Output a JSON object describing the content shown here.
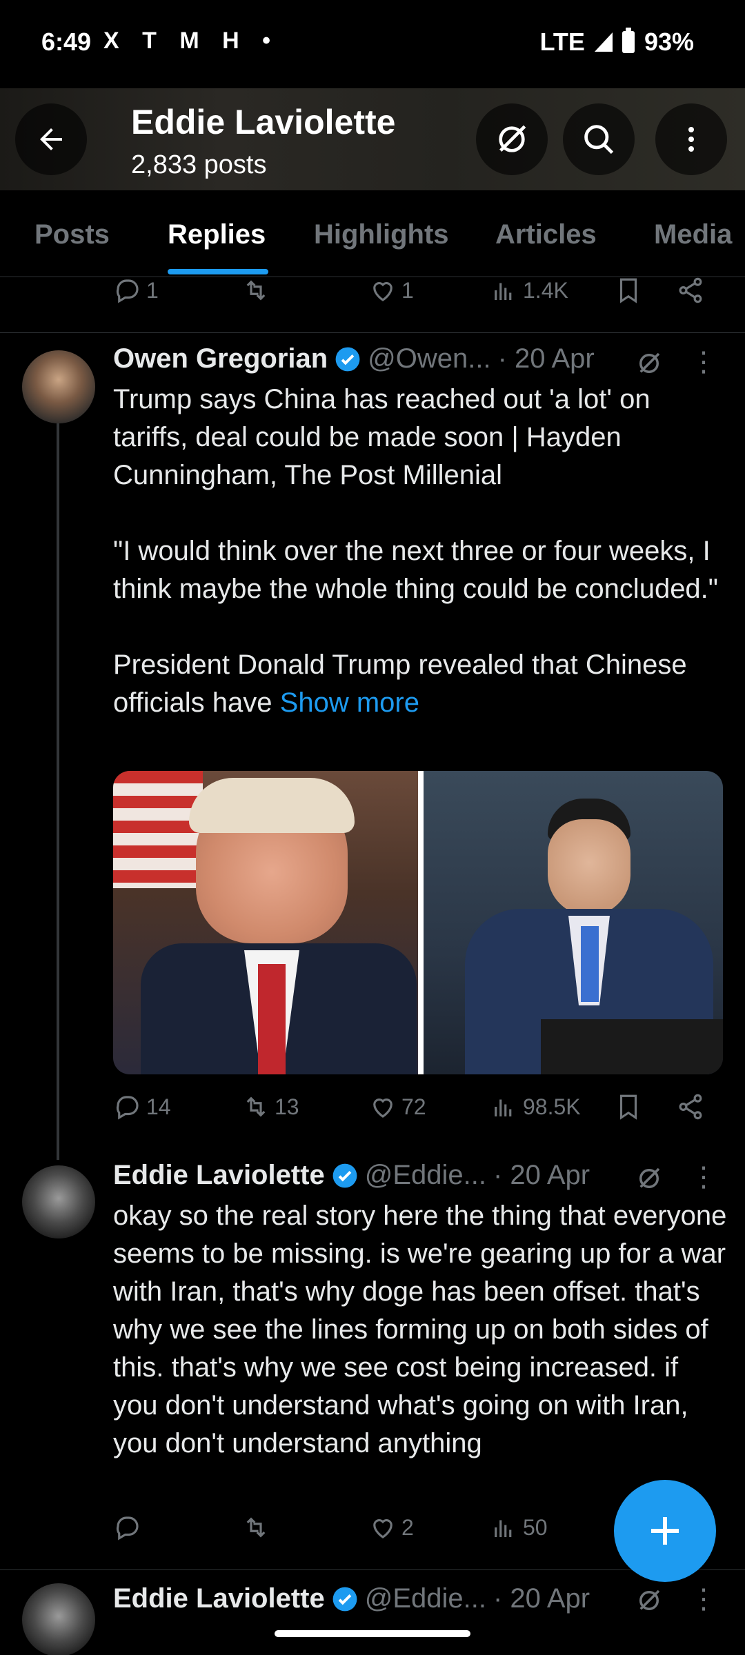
{
  "status_bar": {
    "time": "6:49",
    "network": "LTE",
    "battery": "93%",
    "notif_icons": [
      "X",
      "T",
      "M",
      "H",
      "•"
    ]
  },
  "header": {
    "title": "Eddie Laviolette",
    "subtitle": "2,833 posts"
  },
  "tabs": [
    {
      "label": "Posts",
      "active": false
    },
    {
      "label": "Replies",
      "active": true
    },
    {
      "label": "Highlights",
      "active": false
    },
    {
      "label": "Articles",
      "active": false
    },
    {
      "label": "Media",
      "active": false
    }
  ],
  "prev_tweet_actions": {
    "replies": "1",
    "reposts": "",
    "likes": "1",
    "views": "1.4K"
  },
  "tweet1": {
    "name": "Owen Gregorian",
    "handle": "@Owen...",
    "date": "· 20 Apr",
    "body_p1": "Trump says China has reached out 'a lot' on tariffs, deal could be made soon | Hayden Cunningham, The Post Millenial",
    "body_p2": "\"I would think over the next three or four weeks, I think maybe the whole thing could be concluded.\"",
    "body_p3": "President Donald Trump revealed that Chinese officials have",
    "show_more": "Show more",
    "actions": {
      "replies": "14",
      "reposts": "13",
      "likes": "72",
      "views": "98.5K"
    }
  },
  "tweet2": {
    "name": "Eddie Laviolette",
    "handle": "@Eddie...",
    "date": "· 20 Apr",
    "body": "okay so the real story here the thing that everyone seems to be missing. is we're gearing up for a war with Iran, that's why doge has been offset. that's why we see the lines forming up on both sides of this. that's why we see cost being increased. if you don't understand what's going on with Iran, you don't understand anything",
    "actions": {
      "replies": "",
      "reposts": "",
      "likes": "2",
      "views": "50"
    }
  },
  "tweet3": {
    "name": "Eddie Laviolette",
    "handle": "@Eddie...",
    "date": "· 20 Apr"
  },
  "colors": {
    "accent": "#1d9bf0",
    "muted": "#71767b",
    "text": "#e7e9ea",
    "background": "#000000"
  }
}
